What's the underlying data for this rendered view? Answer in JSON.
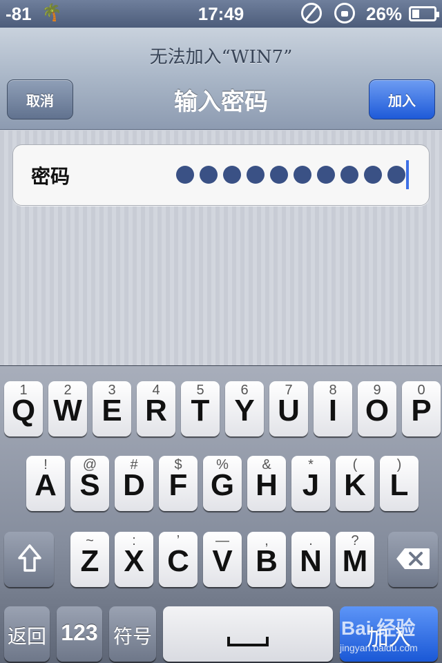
{
  "status_bar": {
    "signal": "-81",
    "time": "17:49",
    "battery_percent": "26%",
    "icons": [
      "palm-tree-icon",
      "timer-icon",
      "rotation-lock-icon",
      "battery-icon"
    ]
  },
  "nav": {
    "prompt": "无法加入“WIN7”",
    "title": "输入密码",
    "cancel_label": "取消",
    "join_label": "加入"
  },
  "field": {
    "label": "密码",
    "masked_char_count": 10
  },
  "keyboard": {
    "row1": [
      {
        "sym": "1",
        "ltr": "Q"
      },
      {
        "sym": "2",
        "ltr": "W"
      },
      {
        "sym": "3",
        "ltr": "E"
      },
      {
        "sym": "4",
        "ltr": "R"
      },
      {
        "sym": "5",
        "ltr": "T"
      },
      {
        "sym": "6",
        "ltr": "Y"
      },
      {
        "sym": "7",
        "ltr": "U"
      },
      {
        "sym": "8",
        "ltr": "I"
      },
      {
        "sym": "9",
        "ltr": "O"
      },
      {
        "sym": "0",
        "ltr": "P"
      }
    ],
    "row2": [
      {
        "sym": "!",
        "ltr": "A"
      },
      {
        "sym": "@",
        "ltr": "S"
      },
      {
        "sym": "#",
        "ltr": "D"
      },
      {
        "sym": "$",
        "ltr": "F"
      },
      {
        "sym": "%",
        "ltr": "G"
      },
      {
        "sym": "&",
        "ltr": "H"
      },
      {
        "sym": "*",
        "ltr": "J"
      },
      {
        "sym": "(",
        "ltr": "K"
      },
      {
        "sym": ")",
        "ltr": "L"
      }
    ],
    "row3": [
      {
        "sym": "~",
        "ltr": "Z"
      },
      {
        "sym": ":",
        "ltr": "X"
      },
      {
        "sym": "’",
        "ltr": "C"
      },
      {
        "sym": "—",
        "ltr": "V"
      },
      {
        "sym": ",",
        "ltr": "B"
      },
      {
        "sym": ".",
        "ltr": "N"
      },
      {
        "sym": "?",
        "ltr": "M"
      }
    ],
    "back_label": "返回",
    "num_label": "123",
    "symbol_label": "符号",
    "join_label": "加入"
  },
  "watermark": {
    "logo": "Bai 经验",
    "url": "jingyan.baidu.com"
  }
}
